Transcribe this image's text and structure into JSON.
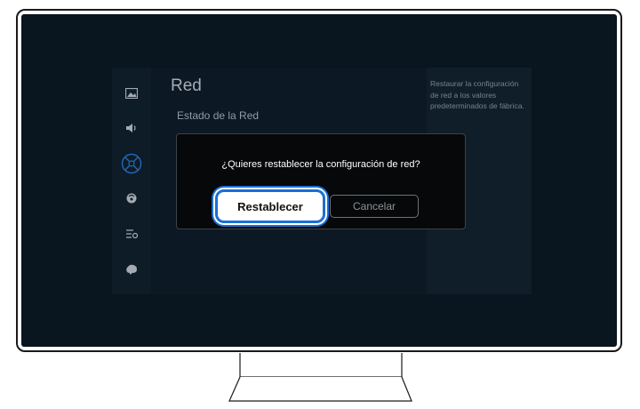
{
  "menu": {
    "title": "Red",
    "item": "Estado de la Red",
    "help_text": "Restaurar la configuración de red a los valores predeterminados de fábrica.",
    "rail_icons": [
      "picture-icon",
      "sound-icon",
      "network-icon",
      "broadcast-icon",
      "general-icon",
      "support-icon"
    ]
  },
  "dialog": {
    "message": "¿Quieres restablecer la configuración de red?",
    "reset_label": "Restablecer",
    "cancel_label": "Cancelar"
  },
  "colors": {
    "focus": "#1a6fd6",
    "screen": "#0c1a26",
    "dialog": "#060809"
  }
}
